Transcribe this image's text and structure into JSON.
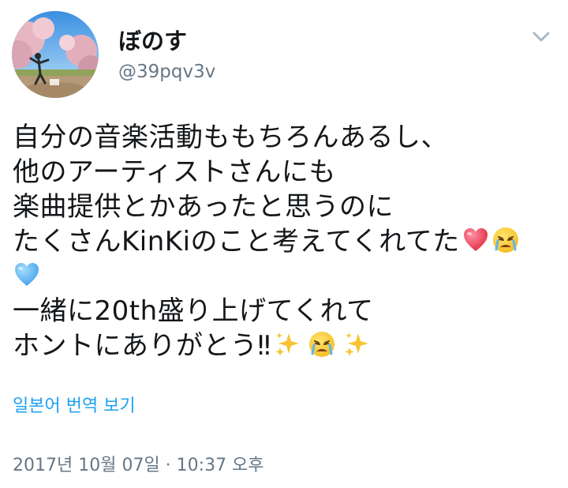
{
  "user": {
    "display_name": "ぼのす",
    "handle": "@39pqv3v"
  },
  "tweet": {
    "line1": "自分の音楽活動ももちろんあるし、",
    "line2": "他のアーティストさんにも",
    "line3": "楽曲提供とかあったと思うのに",
    "line4": "たくさんKinKiのこと考えてくれてた",
    "line6": "一緒に20th盛り上げてくれて",
    "line7": "ホントにありがとう‼"
  },
  "translate_label": "일본어 번역 보기",
  "timestamp": "2017년 10월 07일 · 10:37 오후",
  "icons": {
    "menu": "chevron-down-icon",
    "emojis": [
      "red-heart-icon",
      "crying-face-icon",
      "blue-heart-icon",
      "sparkles-icon",
      "crying-face-icon",
      "sparkles-icon"
    ]
  },
  "colors": {
    "text": "#14171a",
    "secondary": "#657786",
    "link": "#1da1f2"
  }
}
